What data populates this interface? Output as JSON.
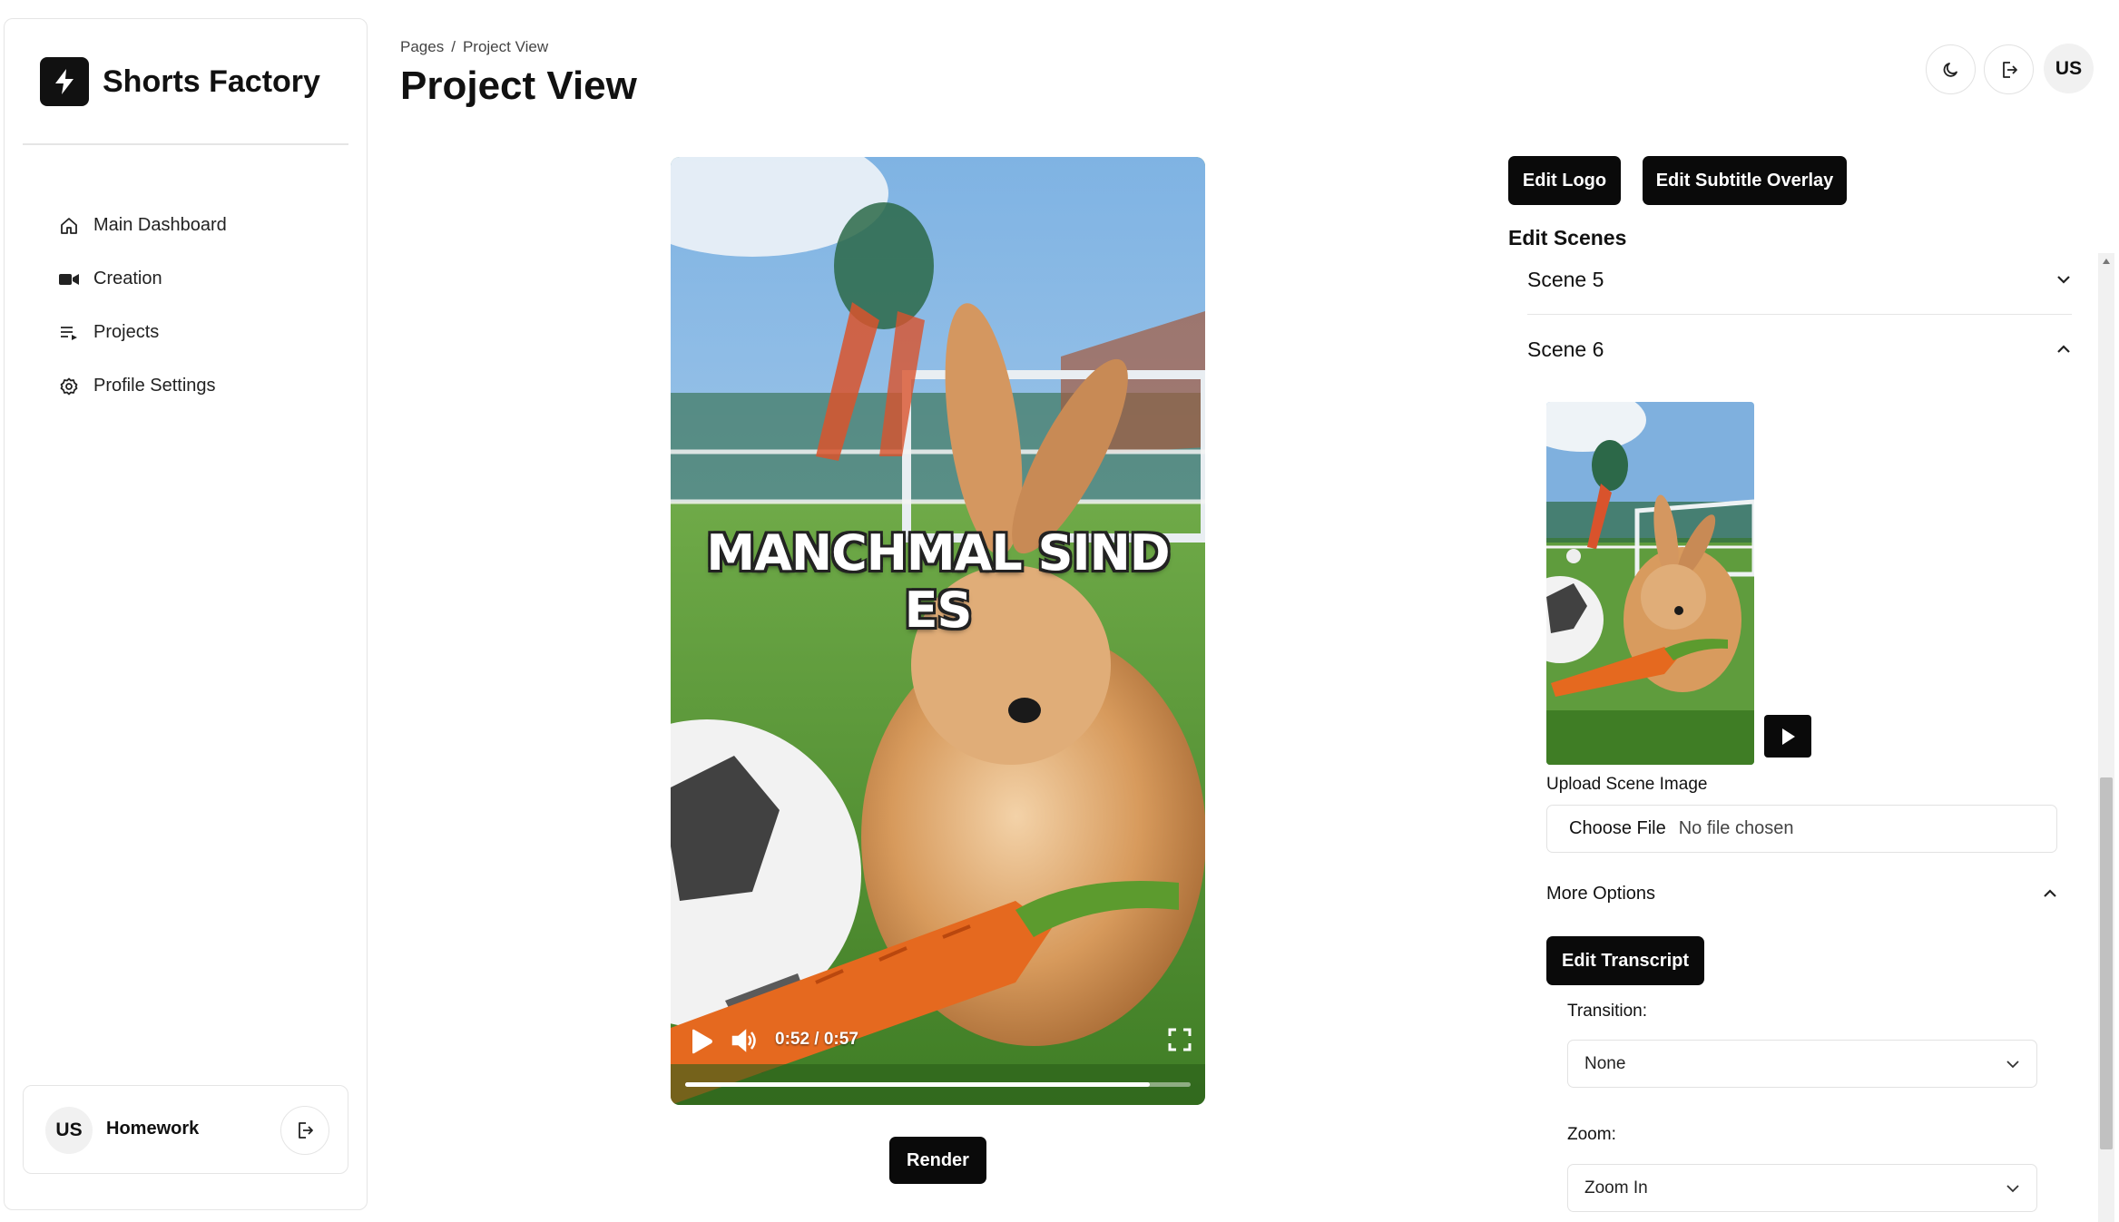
{
  "sidebar": {
    "brand": "Shorts Factory",
    "nav": [
      {
        "label": "Main Dashboard",
        "icon": "home-icon"
      },
      {
        "label": "Creation",
        "icon": "video-camera-icon"
      },
      {
        "label": "Projects",
        "icon": "playlist-icon"
      },
      {
        "label": "Profile Settings",
        "icon": "gear-icon"
      }
    ],
    "user": {
      "initials": "US",
      "name": "Homework"
    }
  },
  "header": {
    "breadcrumb": [
      "Pages",
      "Project View"
    ],
    "title": "Project View",
    "avatar_initials": "US"
  },
  "video": {
    "subtitle": "MANCHMAL SIND ES",
    "time": "0:52 / 0:57",
    "progress": 0.92,
    "render_label": "Render"
  },
  "editor": {
    "edit_logo_label": "Edit Logo",
    "edit_subtitle_label": "Edit Subtitle Overlay",
    "section_title": "Edit Scenes",
    "scenes": [
      {
        "label": "Scene 5",
        "expanded": false
      },
      {
        "label": "Scene 6",
        "expanded": true
      }
    ],
    "upload_label": "Upload Scene Image",
    "choose_file": "Choose File",
    "no_file": "No file chosen",
    "more_options": "More Options",
    "edit_transcript_label": "Edit Transcript",
    "transition_label": "Transition:",
    "transition_value": "None",
    "zoom_label": "Zoom:",
    "zoom_value": "Zoom In"
  },
  "colors": {
    "primary": "#0a0a0a",
    "border": "#e5e5e5",
    "accent": "#ffffff"
  }
}
